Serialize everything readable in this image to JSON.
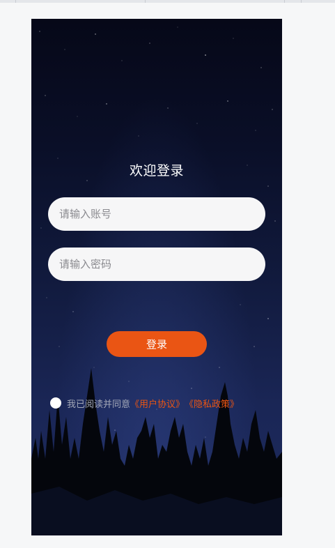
{
  "login": {
    "title": "欢迎登录",
    "account_placeholder": "请输入账号",
    "password_placeholder": "请输入密码",
    "login_button": "登录"
  },
  "agreement": {
    "checked": false,
    "text": "我已阅读并同意",
    "user_agreement": "《用户协议》",
    "privacy_policy": "《隐私政策》"
  },
  "colors": {
    "accent": "#ea5514",
    "background_top": "#060818",
    "background_bottom": "#1e2b5e",
    "field_background": "#f6f6f7"
  },
  "icons": [
    "agree-radio-icon"
  ]
}
